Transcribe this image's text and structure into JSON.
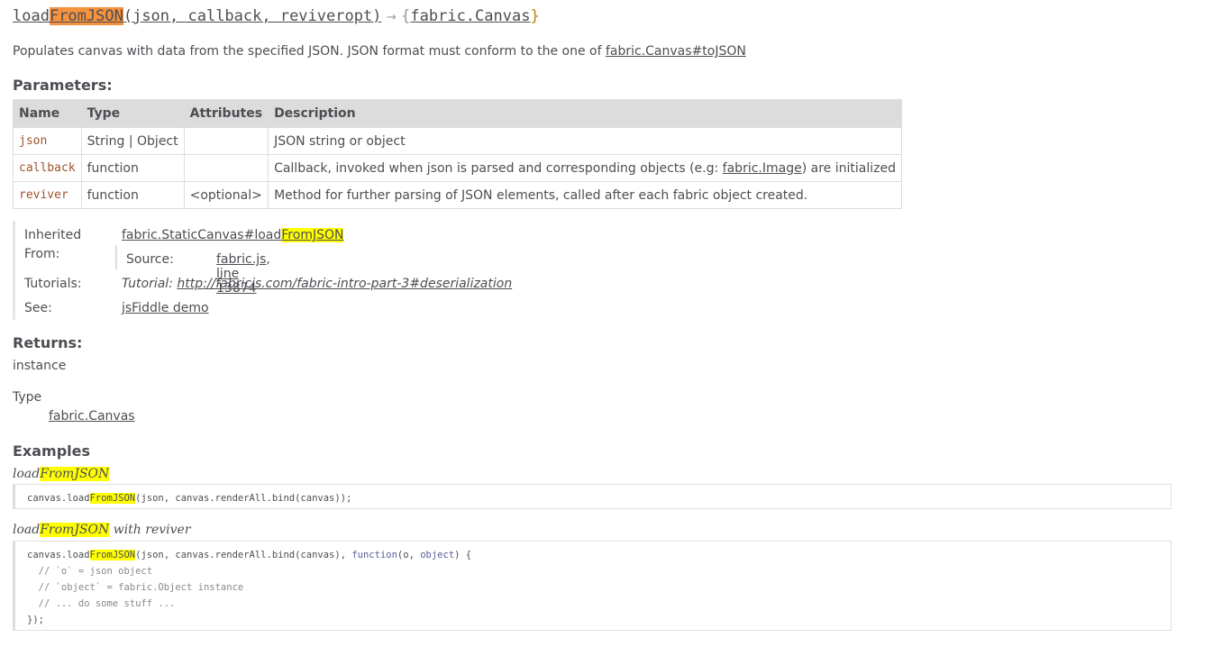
{
  "signature": {
    "name_prefix": "load",
    "name_highlight": "FromJSON",
    "params_text": "(json, callback, reviveropt)",
    "arrow": "→",
    "brace_open": "{",
    "return_type": "fabric.Canvas",
    "brace_close": "}"
  },
  "description": {
    "text": "Populates canvas with data from the specified JSON. JSON format must conform to the one of ",
    "link": "fabric.Canvas#toJSON"
  },
  "parameters": {
    "heading": "Parameters:",
    "headers": [
      "Name",
      "Type",
      "Attributes",
      "Description"
    ],
    "rows": [
      {
        "name": "json",
        "type": "String | Object",
        "attributes": "",
        "description": "JSON string or object"
      },
      {
        "name": "callback",
        "type": "function",
        "attributes": "",
        "description_pre": "Callback, invoked when json is parsed and corresponding objects (e.g: ",
        "description_link": "fabric.Image",
        "description_post": ") are initialized"
      },
      {
        "name": "reviver",
        "type": "function",
        "attributes": "<optional>",
        "description": "Method for further parsing of JSON elements, called after each fabric object created."
      }
    ]
  },
  "details": {
    "inherited_label_1": "Inherited",
    "inherited_label_2": "From:",
    "inherited_link_prefix": "fabric.StaticCanvas#load",
    "inherited_link_highlight": "FromJSON",
    "source_label": "Source:",
    "source_file": "fabric.js",
    "source_sep": ", ",
    "source_line": "line 13874",
    "tutorials_label": "Tutorials:",
    "tutorial_prefix": "Tutorial: ",
    "tutorial_link": "http://fabricjs.com/fabric-intro-part-3#deserialization",
    "see_label": "See:",
    "see_link": "jsFiddle demo"
  },
  "returns": {
    "heading": "Returns:",
    "value": "instance",
    "type_label": "Type",
    "type_value": "fabric.Canvas"
  },
  "examples": {
    "heading": "Examples",
    "ex1_caption_prefix": "load",
    "ex1_caption_highlight": "FromJSON",
    "ex1_code_prefix": "canvas.load",
    "ex1_code_highlight": "FromJSON",
    "ex1_code_rest": "(json, canvas.renderAll.bind(canvas));",
    "ex2_caption_prefix": "load",
    "ex2_caption_highlight": "FromJSON",
    "ex2_caption_suffix": " with reviver",
    "ex2_line1_prefix": "canvas.load",
    "ex2_line1_highlight": "FromJSON",
    "ex2_line1_mid": "(json, canvas.renderAll.bind(canvas), ",
    "ex2_line1_kw": "function",
    "ex2_line1_args_open": "(o, ",
    "ex2_line1_kw2": "object",
    "ex2_line1_end": ") {",
    "ex2_line2": "  // `o` = json object",
    "ex2_line3": "  // `object` = fabric.Object instance",
    "ex2_line4": "  // ... do some stuff ...",
    "ex2_line5": "});"
  }
}
